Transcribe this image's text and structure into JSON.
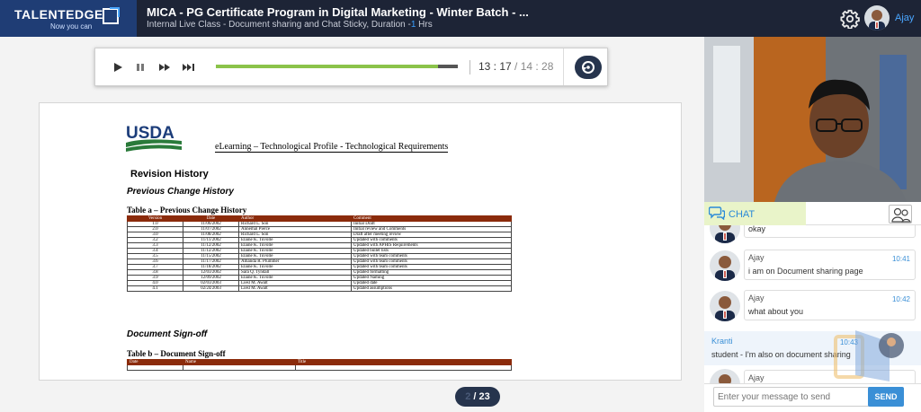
{
  "header": {
    "logo_name": "TALENTEDGE",
    "logo_tagline": "Now you can",
    "title": "MICA - PG Certificate Program in Digital Marketing - Winter Batch - ...",
    "subtitle_prefix": "Internal Live Class - Document sharing and Chat Sticky,  Duration -",
    "duration_value": "1",
    "duration_unit": " Hrs",
    "user_name": "Ajay"
  },
  "player": {
    "current_time": "13 : 17",
    "total_time": " / 14 : 28",
    "progress_fraction": 0.919
  },
  "document": {
    "logo_text": "USDA",
    "heading": "eLearning – Technological Profile - Technological Requirements",
    "revision_title": "Revision History",
    "previous_change_title": "Previous Change History",
    "table_a_caption": "Table a – Previous Change History",
    "table_a_headers": [
      "Version",
      "Date",
      "Author",
      "Comment"
    ],
    "table_a_rows": [
      [
        "1.0",
        "11/06/2002",
        "Richard L. Son",
        "Initial Draft"
      ],
      [
        "2.0",
        "11/07/2002",
        "Annemal Pierce",
        "Initial review and Comments"
      ],
      [
        "3.0",
        "11/08/2002",
        "Richard L. Son",
        "Draft after meeting review"
      ],
      [
        "3.2",
        "11/11/2002",
        "Elaine K. Tuvolle",
        "Updated with comments"
      ],
      [
        "3.3",
        "11/12/2002",
        "Elaine K. Tuvolle",
        "Updated with APHIS Requirements"
      ],
      [
        "3.4",
        "11/12/2002",
        "Elaine K. Tuvolle",
        "Updated bullet lists"
      ],
      [
        "3.5",
        "11/15/2002",
        "Elaine K. Tuvolle",
        "Updated with team comments"
      ],
      [
        "3.6",
        "11/17/2002",
        "Amanda R. Plummer",
        "Updated with team comments"
      ],
      [
        "3.7",
        "11/18/2002",
        "Elaine K. Tuvolle",
        "Updated with team comments"
      ],
      [
        "3.8",
        "12/03/2002",
        "Sara Q. Tyndall",
        "Updated formatting"
      ],
      [
        "3.9",
        "12/09/2002",
        "Elaine K. Tuvolle",
        "Updated Naming"
      ],
      [
        "4.0",
        "02/03/2003",
        "Liesl M. Awalt",
        "Updated date"
      ],
      [
        "4.1",
        "02/24/2003",
        "Liesl M. Awalt",
        "Updated assumptions"
      ]
    ],
    "signoff_title": "Document Sign-off",
    "table_b_caption": "Table b – Document Sign-off",
    "table_b_headers": [
      "Date",
      "Name",
      "Title"
    ]
  },
  "pager": {
    "current": "2",
    "total": "/ 23"
  },
  "chat": {
    "tab_label": "CHAT",
    "messages": [
      {
        "name": "",
        "time": "",
        "text": "okay"
      },
      {
        "name": "Ajay",
        "time": "10:41",
        "text": "i am on Document sharing page"
      },
      {
        "name": "Ajay",
        "time": "10:42",
        "text": "what about you"
      },
      {
        "name": "Kranti",
        "time": "10:43",
        "text": "student - I'm also on document sharing"
      },
      {
        "name": "Ajay",
        "time": "",
        "text": ""
      }
    ],
    "input_placeholder": "Enter your message to send",
    "send_label": "SEND"
  },
  "colors": {
    "topbar": "#1d2436",
    "logo_bg": "#1f3d75",
    "accent": "#3a8fd6",
    "progress": "#8bc34a",
    "table_header": "#8b2b0b"
  }
}
